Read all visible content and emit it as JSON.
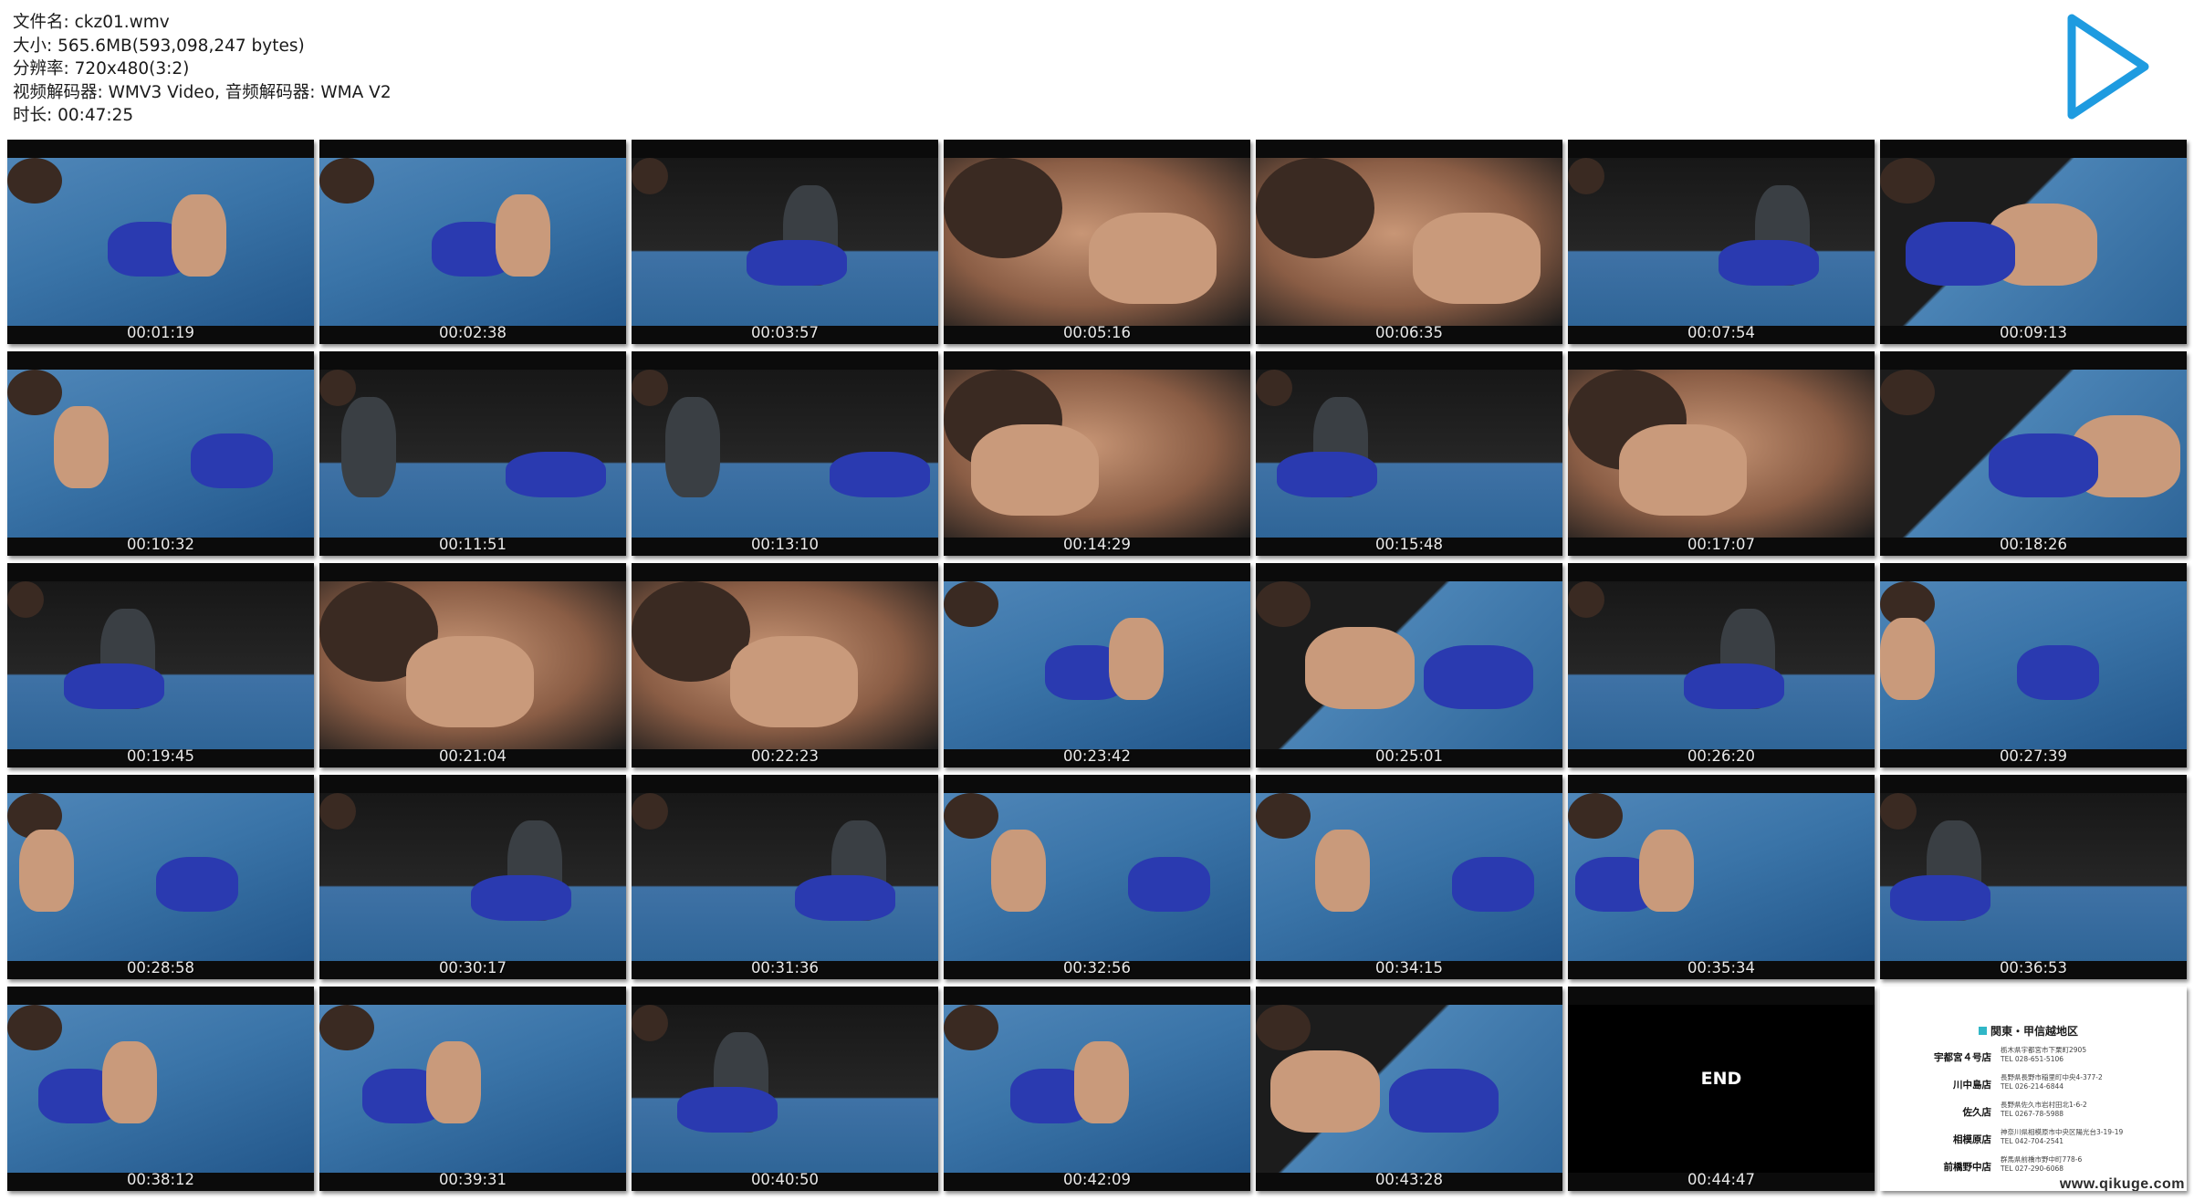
{
  "info": {
    "filename": "文件名: ckz01.wmv",
    "size": "大小: 565.6MB(593,098,247 bytes)",
    "resolution": "分辨率: 720x480(3:2)",
    "codecs": "视频解码器: WMV3 Video, 音频解码器: WMA V2",
    "duration": "时长: 00:47:25"
  },
  "play_icon": "play-triangle-icon",
  "accent_color": "#1e9be0",
  "thumbnails": [
    {
      "time": "00:01:19",
      "scene": "mat"
    },
    {
      "time": "00:02:38",
      "scene": "mat"
    },
    {
      "time": "00:03:57",
      "scene": "dark"
    },
    {
      "time": "00:05:16",
      "scene": "skin"
    },
    {
      "time": "00:06:35",
      "scene": "skin"
    },
    {
      "time": "00:07:54",
      "scene": "dark"
    },
    {
      "time": "00:09:13",
      "scene": "mixed"
    },
    {
      "time": "00:10:32",
      "scene": "mat"
    },
    {
      "time": "00:11:51",
      "scene": "dark"
    },
    {
      "time": "00:13:10",
      "scene": "dark"
    },
    {
      "time": "00:14:29",
      "scene": "skin"
    },
    {
      "time": "00:15:48",
      "scene": "dark"
    },
    {
      "time": "00:17:07",
      "scene": "skin"
    },
    {
      "time": "00:18:26",
      "scene": "mixed"
    },
    {
      "time": "00:19:45",
      "scene": "dark"
    },
    {
      "time": "00:21:04",
      "scene": "skin"
    },
    {
      "time": "00:22:23",
      "scene": "skin"
    },
    {
      "time": "00:23:42",
      "scene": "mat"
    },
    {
      "time": "00:25:01",
      "scene": "mixed"
    },
    {
      "time": "00:26:20",
      "scene": "dark"
    },
    {
      "time": "00:27:39",
      "scene": "mat"
    },
    {
      "time": "00:28:58",
      "scene": "mat"
    },
    {
      "time": "00:30:17",
      "scene": "dark"
    },
    {
      "time": "00:31:36",
      "scene": "dark"
    },
    {
      "time": "00:32:56",
      "scene": "mat"
    },
    {
      "time": "00:34:15",
      "scene": "mat"
    },
    {
      "time": "00:35:34",
      "scene": "mat"
    },
    {
      "time": "00:36:53",
      "scene": "dark"
    },
    {
      "time": "00:38:12",
      "scene": "mat"
    },
    {
      "time": "00:39:31",
      "scene": "mat"
    },
    {
      "time": "00:40:50",
      "scene": "dark"
    },
    {
      "time": "00:42:09",
      "scene": "mat"
    },
    {
      "time": "00:43:28",
      "scene": "mixed"
    },
    {
      "time": "00:44:47",
      "scene": "end",
      "end_text": "END"
    },
    {
      "time": "",
      "scene": "card"
    }
  ],
  "store_card": {
    "header": "関東・甲信越地区",
    "stores": [
      {
        "name": "宇都宮４号店",
        "address": "栃木県宇都宮市下栗町2905",
        "tel": "TEL 028-651-5106"
      },
      {
        "name": "川中島店",
        "address": "長野県長野市稲里町中央4-377-2",
        "tel": "TEL 026-214-6844"
      },
      {
        "name": "佐久店",
        "address": "長野県佐久市岩村田北1-6-2",
        "tel": "TEL 0267-78-5988"
      },
      {
        "name": "相模原店",
        "address": "神奈川県相模原市中央区陽光台3-19-19",
        "tel": "TEL 042-704-2541"
      },
      {
        "name": "前橋野中店",
        "address": "群馬県前橋市野中町778-6",
        "tel": "TEL 027-290-6068"
      }
    ]
  },
  "watermark": "www.qikuge.com"
}
